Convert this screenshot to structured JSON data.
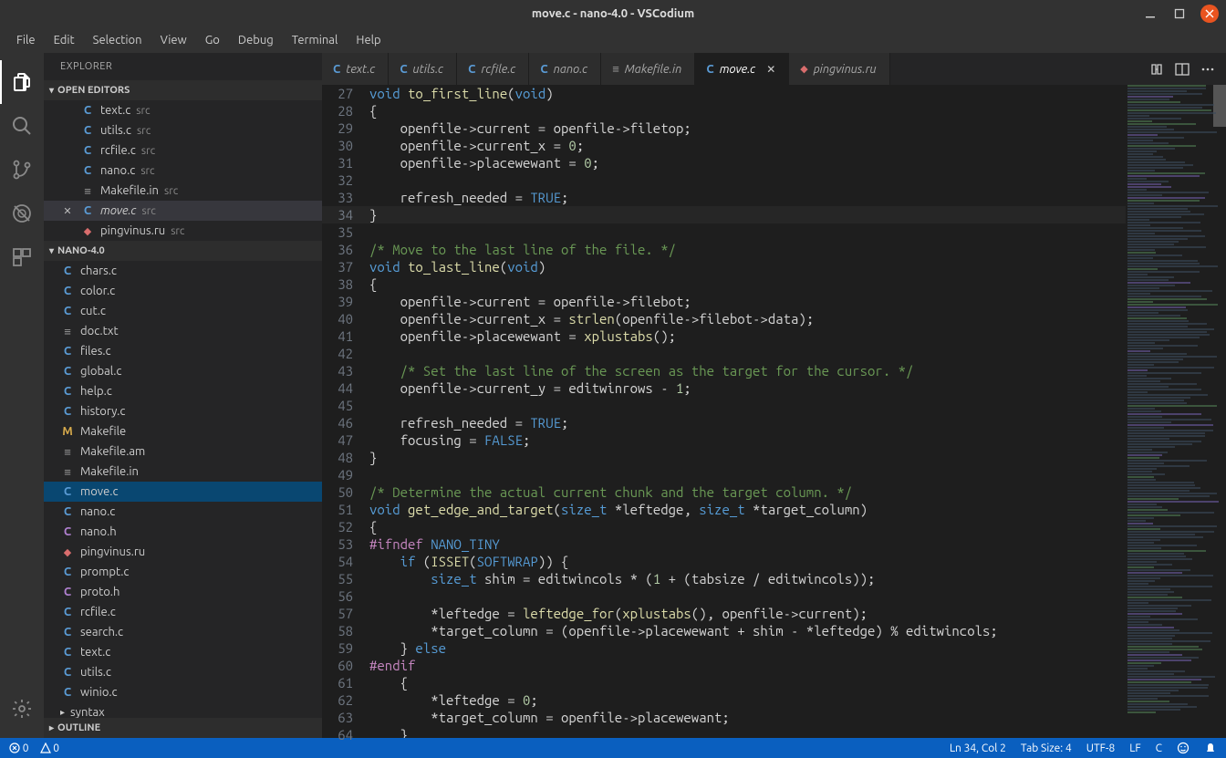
{
  "window": {
    "title": "move.c - nano-4.0 - VSCodium"
  },
  "menubar": [
    "File",
    "Edit",
    "Selection",
    "View",
    "Go",
    "Debug",
    "Terminal",
    "Help"
  ],
  "sidebar": {
    "title": "EXPLORER",
    "sections": {
      "open_editors": {
        "label": "OPEN EDITORS",
        "items": [
          {
            "icon": "C",
            "name": "text.c",
            "dir": "src"
          },
          {
            "icon": "C",
            "name": "utils.c",
            "dir": "src"
          },
          {
            "icon": "C",
            "name": "rcfile.c",
            "dir": "src"
          },
          {
            "icon": "C",
            "name": "nano.c",
            "dir": "src"
          },
          {
            "icon": "≡",
            "name": "Makefile.in",
            "dir": "src"
          },
          {
            "icon": "C",
            "name": "move.c",
            "dir": "src",
            "active": true,
            "close": true
          },
          {
            "icon": "ru",
            "name": "pingvinus.ru",
            "dir": "src"
          }
        ]
      },
      "project": {
        "label": "NANO-4.0",
        "items": [
          {
            "icon": "C",
            "name": "chars.c"
          },
          {
            "icon": "C",
            "name": "color.c"
          },
          {
            "icon": "C",
            "name": "cut.c"
          },
          {
            "icon": "≡",
            "name": "doc.txt"
          },
          {
            "icon": "C",
            "name": "files.c"
          },
          {
            "icon": "C",
            "name": "global.c"
          },
          {
            "icon": "C",
            "name": "help.c"
          },
          {
            "icon": "C",
            "name": "history.c"
          },
          {
            "icon": "M",
            "name": "Makefile"
          },
          {
            "icon": "≡",
            "name": "Makefile.am"
          },
          {
            "icon": "≡",
            "name": "Makefile.in"
          },
          {
            "icon": "C",
            "name": "move.c",
            "selected": true
          },
          {
            "icon": "C",
            "name": "nano.c"
          },
          {
            "icon": "C",
            "name": "nano.h",
            "h": true
          },
          {
            "icon": "ru",
            "name": "pingvinus.ru"
          },
          {
            "icon": "C",
            "name": "prompt.c"
          },
          {
            "icon": "C",
            "name": "proto.h",
            "h": true
          },
          {
            "icon": "C",
            "name": "rcfile.c"
          },
          {
            "icon": "C",
            "name": "search.c"
          },
          {
            "icon": "C",
            "name": "text.c"
          },
          {
            "icon": "C",
            "name": "utils.c"
          },
          {
            "icon": "C",
            "name": "winio.c"
          },
          {
            "icon": "▸",
            "name": "syntax",
            "folder": true
          }
        ]
      },
      "outline": {
        "label": "OUTLINE"
      }
    }
  },
  "tabs": [
    {
      "icon": "C",
      "label": "text.c"
    },
    {
      "icon": "C",
      "label": "utils.c"
    },
    {
      "icon": "C",
      "label": "rcfile.c"
    },
    {
      "icon": "C",
      "label": "nano.c"
    },
    {
      "icon": "≡",
      "label": "Makefile.in"
    },
    {
      "icon": "C",
      "label": "move.c",
      "active": true
    },
    {
      "icon": "ru",
      "label": "pingvinus.ru"
    }
  ],
  "editor": {
    "first_line_number": 27,
    "highlight_line": 34,
    "lines": [
      [
        [
          "tok-kw",
          "void"
        ],
        [
          "",
          " "
        ],
        [
          "tok-fn",
          "to_first_line"
        ],
        [
          "",
          "("
        ],
        [
          "tok-kw",
          "void"
        ],
        [
          "",
          ")"
        ]
      ],
      [
        [
          "",
          "{"
        ]
      ],
      [
        [
          "",
          "    openfile->current = openfile->filetop;"
        ]
      ],
      [
        [
          "",
          "    openfile->current_x = "
        ],
        [
          "tok-num",
          "0"
        ],
        [
          "",
          ";"
        ]
      ],
      [
        [
          "",
          "    openfile->placewewant = "
        ],
        [
          "tok-num",
          "0"
        ],
        [
          "",
          ";"
        ]
      ],
      [
        [
          "",
          ""
        ]
      ],
      [
        [
          "",
          "    refresh_needed = "
        ],
        [
          "tok-const",
          "TRUE"
        ],
        [
          "",
          ";"
        ]
      ],
      [
        [
          "",
          "}"
        ]
      ],
      [
        [
          "",
          ""
        ]
      ],
      [
        [
          "tok-comment",
          "/* Move to the last line of the file. */"
        ]
      ],
      [
        [
          "tok-kw",
          "void"
        ],
        [
          "",
          " "
        ],
        [
          "tok-fn",
          "to_last_line"
        ],
        [
          "",
          "("
        ],
        [
          "tok-kw",
          "void"
        ],
        [
          "",
          ")"
        ]
      ],
      [
        [
          "",
          "{"
        ]
      ],
      [
        [
          "",
          "    openfile->current = openfile->filebot;"
        ]
      ],
      [
        [
          "",
          "    openfile->current_x = "
        ],
        [
          "tok-call",
          "strlen"
        ],
        [
          "",
          "(openfile->filebot->data);"
        ]
      ],
      [
        [
          "",
          "    openfile->placewewant = "
        ],
        [
          "tok-call",
          "xplustabs"
        ],
        [
          "",
          "();"
        ]
      ],
      [
        [
          "",
          ""
        ]
      ],
      [
        [
          "",
          "    "
        ],
        [
          "tok-comment",
          "/* Set the last line of the screen as the target for the cursor. */"
        ]
      ],
      [
        [
          "",
          "    openfile->current_y = editwinrows - "
        ],
        [
          "tok-num",
          "1"
        ],
        [
          "",
          ";"
        ]
      ],
      [
        [
          "",
          ""
        ]
      ],
      [
        [
          "",
          "    refresh_needed = "
        ],
        [
          "tok-const",
          "TRUE"
        ],
        [
          "",
          ";"
        ]
      ],
      [
        [
          "",
          "    focusing = "
        ],
        [
          "tok-const",
          "FALSE"
        ],
        [
          "",
          ";"
        ]
      ],
      [
        [
          "",
          "}"
        ]
      ],
      [
        [
          "",
          ""
        ]
      ],
      [
        [
          "tok-comment",
          "/* Determine the actual current chunk and the target column. */"
        ]
      ],
      [
        [
          "tok-kw",
          "void"
        ],
        [
          "",
          " "
        ],
        [
          "tok-fn",
          "get_edge_and_target"
        ],
        [
          "",
          "("
        ],
        [
          "tok-sizt",
          "size_t"
        ],
        [
          "",
          " *leftedge, "
        ],
        [
          "tok-sizt",
          "size_t"
        ],
        [
          "",
          " *target_column)"
        ]
      ],
      [
        [
          "",
          "{"
        ]
      ],
      [
        [
          "tok-macro",
          "#ifndef"
        ],
        [
          "",
          " "
        ],
        [
          "tok-const",
          "NANO_TINY"
        ]
      ],
      [
        [
          "",
          "    "
        ],
        [
          "tok-kw",
          "if"
        ],
        [
          "",
          " ("
        ],
        [
          "tok-call",
          "ISSET"
        ],
        [
          "",
          "("
        ],
        [
          "tok-const",
          "SOFTWRAP"
        ],
        [
          "",
          ")) {"
        ]
      ],
      [
        [
          "",
          "        "
        ],
        [
          "tok-sizt",
          "size_t"
        ],
        [
          "",
          " shim = editwincols * ("
        ],
        [
          "tok-num",
          "1"
        ],
        [
          "",
          " + (tabsize / editwincols));"
        ]
      ],
      [
        [
          "",
          ""
        ]
      ],
      [
        [
          "",
          "        *leftedge = "
        ],
        [
          "tok-call",
          "leftedge_for"
        ],
        [
          "",
          "("
        ],
        [
          "tok-call",
          "xplustabs"
        ],
        [
          "",
          "(), openfile->current);"
        ]
      ],
      [
        [
          "",
          "        *target_column = (openfile->placewewant + shim - *leftedge) % editwincols;"
        ]
      ],
      [
        [
          "",
          "    } "
        ],
        [
          "tok-kw",
          "else"
        ]
      ],
      [
        [
          "tok-macro",
          "#endif"
        ]
      ],
      [
        [
          "",
          "    {"
        ]
      ],
      [
        [
          "",
          "        *leftedge = "
        ],
        [
          "tok-num",
          "0"
        ],
        [
          "",
          ";"
        ]
      ],
      [
        [
          "",
          "        *target_column = openfile->placewewant;"
        ]
      ],
      [
        [
          "",
          "    }"
        ]
      ]
    ]
  },
  "statusbar": {
    "errors": "0",
    "warnings": "0",
    "position": "Ln 34, Col 2",
    "tabsize": "Tab Size: 4",
    "encoding": "UTF-8",
    "eol": "LF",
    "lang": "C"
  }
}
